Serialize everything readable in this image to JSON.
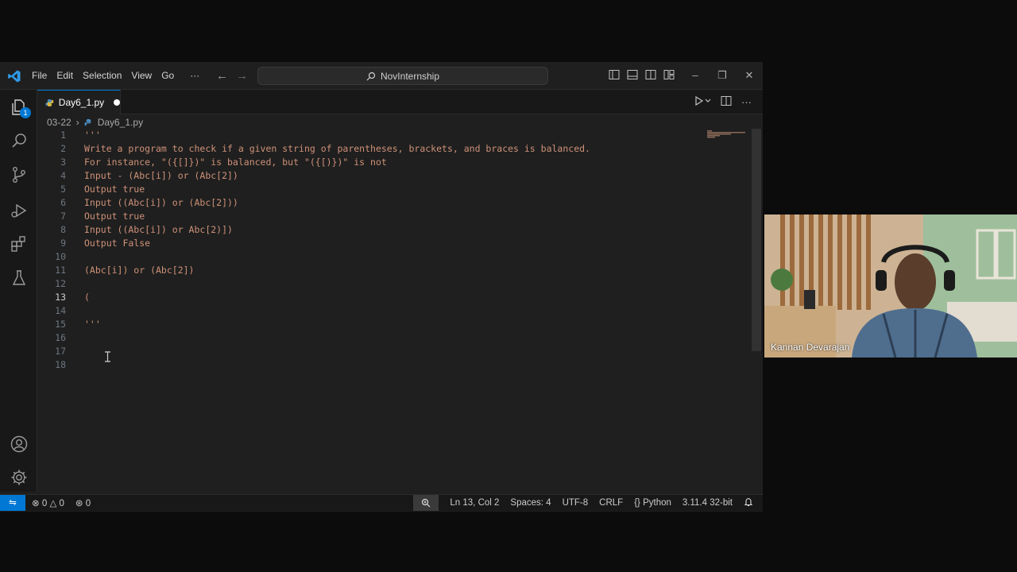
{
  "menu": {
    "items": [
      "File",
      "Edit",
      "Selection",
      "View",
      "Go"
    ],
    "more": "···"
  },
  "search": {
    "text": "NovInternship"
  },
  "activity": {
    "explorer_badge": "1"
  },
  "tab": {
    "name": "Day6_1.py"
  },
  "breadcrumb": {
    "folder": "03-22",
    "file": "Day6_1.py"
  },
  "editor": {
    "current_line": 13,
    "lines": [
      {
        "n": "1",
        "text": "'''"
      },
      {
        "n": "2",
        "text": "Write a program to check if a given string of parentheses, brackets, and braces is balanced."
      },
      {
        "n": "3",
        "text": "For instance, \"({[]})\" is balanced, but \"({[)})\" is not"
      },
      {
        "n": "4",
        "text": "Input - (Abc[i]) or (Abc[2])"
      },
      {
        "n": "5",
        "text": "Output true"
      },
      {
        "n": "6",
        "text": "Input ((Abc[i]) or (Abc[2]))"
      },
      {
        "n": "7",
        "text": "Output true"
      },
      {
        "n": "8",
        "text": "Input ((Abc[i]) or Abc[2)])"
      },
      {
        "n": "9",
        "text": "Output False"
      },
      {
        "n": "10",
        "text": ""
      },
      {
        "n": "11",
        "text": "(Abc[i]) or (Abc[2])"
      },
      {
        "n": "12",
        "text": ""
      },
      {
        "n": "13",
        "text": "("
      },
      {
        "n": "14",
        "text": ""
      },
      {
        "n": "15",
        "text": "'''"
      },
      {
        "n": "16",
        "text": ""
      },
      {
        "n": "17",
        "text": ""
      },
      {
        "n": "18",
        "text": ""
      }
    ]
  },
  "status": {
    "errors": "0",
    "warnings": "0",
    "ports": "0",
    "position": "Ln 13, Col 2",
    "spaces": "Spaces: 4",
    "encoding": "UTF-8",
    "eol": "CRLF",
    "language": "Python",
    "interpreter": "3.11.4 32-bit"
  },
  "webcam": {
    "participant": "Kannan Devarajan"
  },
  "colors": {
    "accent": "#0078d4",
    "string": "#ce9178",
    "background": "#1f1f1f"
  }
}
